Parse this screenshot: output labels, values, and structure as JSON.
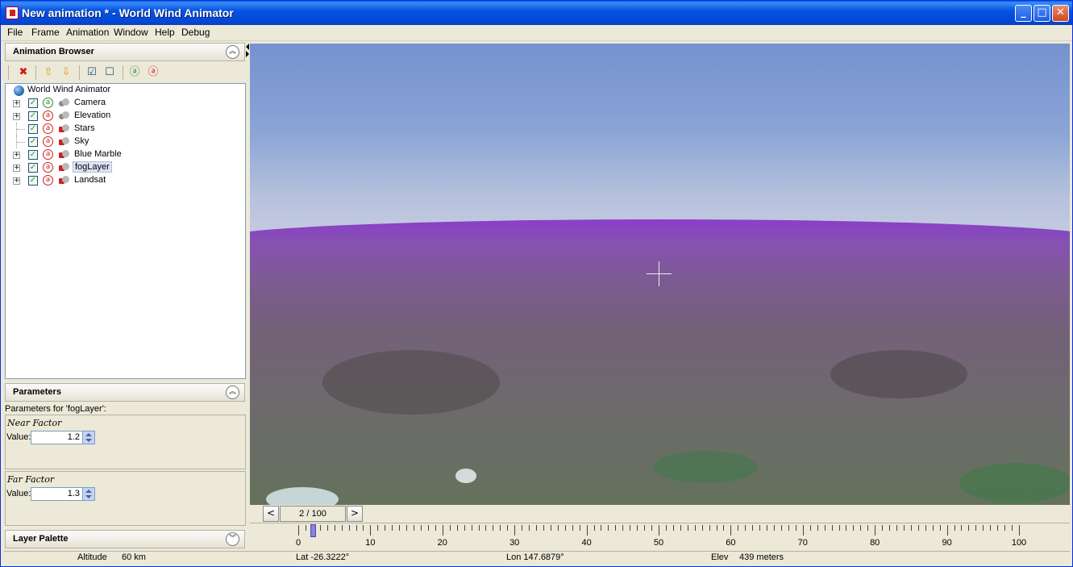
{
  "window": {
    "title": "New animation * - World Wind Animator",
    "minimize": "_",
    "maximize": "□",
    "close": "✕"
  },
  "menu": [
    "File",
    "Frame",
    "Animation",
    "Window",
    "Help",
    "Debug"
  ],
  "animation_browser": {
    "title": "Animation Browser",
    "toolbar_icons": [
      "delete-icon",
      "move-up-icon",
      "move-down-icon",
      "check-all-icon",
      "uncheck-all-icon",
      "animate-all-icon",
      "animate-none-icon"
    ],
    "root": "World Wind Animator",
    "items": [
      {
        "label": "Camera",
        "expandable": true,
        "checked": true,
        "animated": true,
        "selected": false
      },
      {
        "label": "Elevation",
        "expandable": true,
        "checked": true,
        "animated": false,
        "selected": false
      },
      {
        "label": "Stars",
        "expandable": false,
        "checked": true,
        "animated": false,
        "selected": false
      },
      {
        "label": "Sky",
        "expandable": false,
        "checked": true,
        "animated": false,
        "selected": false
      },
      {
        "label": "Blue Marble",
        "expandable": true,
        "checked": true,
        "animated": false,
        "selected": false
      },
      {
        "label": "fogLayer",
        "expandable": true,
        "checked": true,
        "animated": false,
        "selected": true
      },
      {
        "label": "Landsat",
        "expandable": true,
        "checked": true,
        "animated": false,
        "selected": false
      }
    ]
  },
  "parameters": {
    "title": "Parameters",
    "caption": "Parameters for 'fogLayer':",
    "value_label": "Value:",
    "items": [
      {
        "name": "Near Factor",
        "value": "1.2"
      },
      {
        "name": "Far Factor",
        "value": "1.3"
      }
    ]
  },
  "layer_palette": {
    "title": "Layer Palette"
  },
  "timeline": {
    "prev": "<",
    "next": ">",
    "frame_display": "2 / 100",
    "current_frame": 2,
    "total_frames": 100,
    "labels": [
      "0",
      "10",
      "20",
      "30",
      "40",
      "50",
      "60",
      "70",
      "80",
      "90",
      "100"
    ]
  },
  "status": {
    "altitude_label": "Altitude",
    "altitude_value": "60 km",
    "lat": "Lat -26.3222°",
    "lon": "Lon 147.6879°",
    "elev_label": "Elev",
    "elev_value": "439 meters"
  },
  "colors": {
    "accent_selected": "#dde4f3",
    "fog": "#8a3fc9",
    "sky": "#7592cf"
  }
}
